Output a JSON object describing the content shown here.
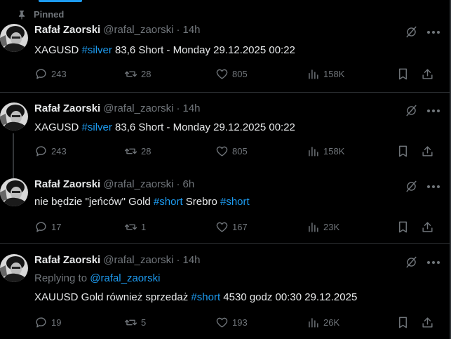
{
  "pinned_label": "Pinned",
  "author": {
    "name": "Rafał Zaorski",
    "handle": "@rafal_zaorski"
  },
  "colors": {
    "background": "#000000",
    "text": "#e7e9ea",
    "muted": "#71767b",
    "link": "#1d9bf0",
    "divider": "#2f3336"
  },
  "tweets": [
    {
      "time": "14h",
      "text_parts": [
        "XAGUSD ",
        "#silver",
        " 83,6 Short - Monday 29.12.2025 00:22"
      ],
      "stats": {
        "replies": "243",
        "reposts": "28",
        "likes": "805",
        "views": "158K"
      }
    },
    {
      "time": "14h",
      "text_parts": [
        "XAGUSD ",
        "#silver",
        " 83,6 Short - Monday 29.12.2025 00:22"
      ],
      "stats": {
        "replies": "243",
        "reposts": "28",
        "likes": "805",
        "views": "158K"
      }
    },
    {
      "time": "6h",
      "text_parts": [
        "nie będzie \"jeńców\" Gold ",
        "#short",
        " Srebro ",
        "#short"
      ],
      "stats": {
        "replies": "17",
        "reposts": "1",
        "likes": "167",
        "views": "23K"
      }
    },
    {
      "time": "14h",
      "reply_prefix": "Replying to ",
      "reply_handle": "@rafal_zaorski",
      "text_parts": [
        "XAUUSD Gold również sprzedaż ",
        "#short",
        " 4530 godz 00:30 29.12.2025"
      ],
      "stats": {
        "replies": "19",
        "reposts": "5",
        "likes": "193",
        "views": "26K"
      }
    }
  ],
  "separator": "·"
}
